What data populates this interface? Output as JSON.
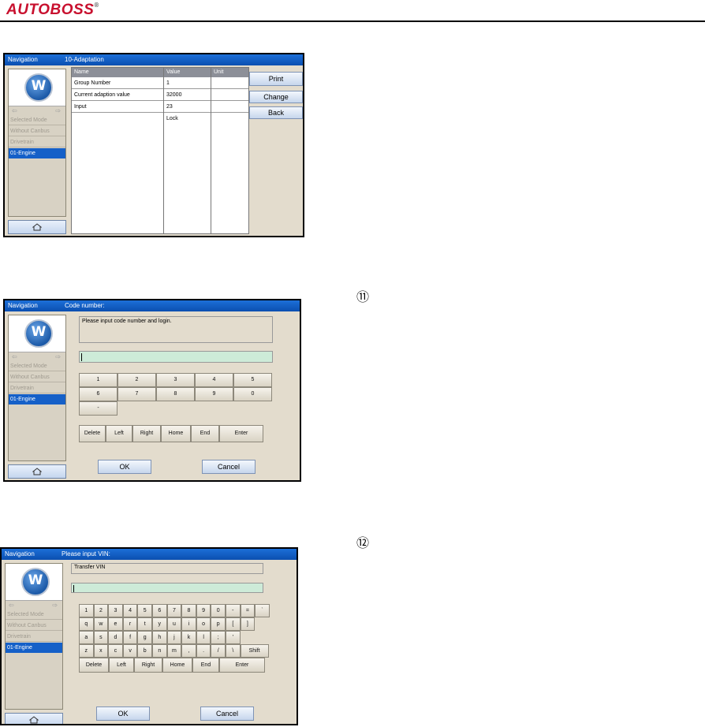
{
  "header": {
    "logo_text": "AUTOBOSS",
    "logo_mark": "®"
  },
  "shared_nav": {
    "title": "Navigation",
    "arrow_left": "⇦",
    "arrow_right": "⇨",
    "items": [
      "Selected Mode",
      "Without Canbus",
      "Drivetrain",
      "01-Engine"
    ],
    "selected_index": 3,
    "brand_icon": "vw-logo-icon",
    "home_icon": "home-icon"
  },
  "screen1": {
    "title": "10-Adaptation",
    "columns": [
      "Name",
      "Value",
      "Unit"
    ],
    "rows": [
      {
        "name": "Group Number",
        "value": "1",
        "unit": ""
      },
      {
        "name": "Current adaption value",
        "value": "32000",
        "unit": ""
      },
      {
        "name": "Input",
        "value": "23",
        "unit": ""
      },
      {
        "name": "",
        "value": "Lock",
        "unit": ""
      }
    ],
    "buttons": {
      "print": "Print",
      "change": "Change",
      "back": "Back"
    }
  },
  "screen2": {
    "marker": "⑪",
    "title": "Code number:",
    "message": "Please input code number and login.",
    "input_value": "",
    "keys_row1": [
      "1",
      "2",
      "3",
      "4",
      "5"
    ],
    "keys_row2": [
      "6",
      "7",
      "8",
      "9",
      "0"
    ],
    "keys_row3": [
      "-"
    ],
    "edit_keys": [
      "Delete",
      "Left",
      "Right",
      "Home",
      "End",
      "Enter"
    ],
    "ok": "OK",
    "cancel": "Cancel"
  },
  "screen3": {
    "marker": "⑫",
    "title": "Please input VIN:",
    "message": "Transfer VIN",
    "input_value": "",
    "row1": [
      "1",
      "2",
      "3",
      "4",
      "5",
      "6",
      "7",
      "8",
      "9",
      "0",
      "-",
      "=",
      "`"
    ],
    "row2": [
      "q",
      "w",
      "e",
      "r",
      "t",
      "y",
      "u",
      "i",
      "o",
      "p",
      "[",
      "]"
    ],
    "row3": [
      "a",
      "s",
      "d",
      "f",
      "g",
      "h",
      "j",
      "k",
      "l",
      ";",
      "'"
    ],
    "row4": [
      "z",
      "x",
      "c",
      "v",
      "b",
      "n",
      "m",
      ",",
      ".",
      "/",
      "\\",
      "Shift"
    ],
    "edit_keys": [
      "Delete",
      "Left",
      "Right",
      "Home",
      "End",
      "Enter"
    ],
    "ok": "OK",
    "cancel": "Cancel"
  }
}
